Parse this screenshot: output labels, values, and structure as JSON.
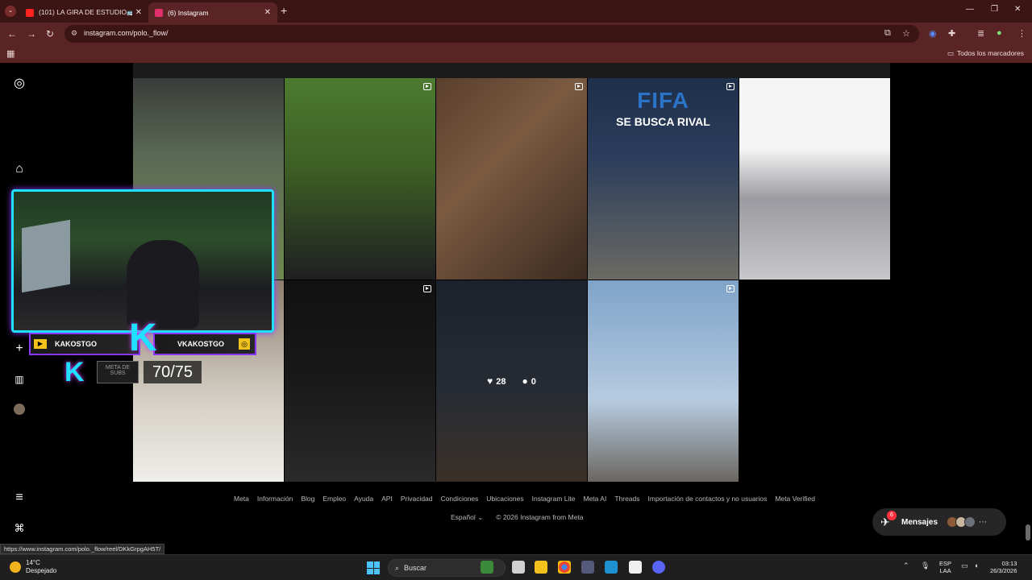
{
  "browser": {
    "tab_menu_icon": "chevron-down-icon",
    "tabs": [
      {
        "label": "(101) LA GIRA DE ESTUDIO🚌🎒",
        "favicon_color": "#ff2020"
      },
      {
        "label": "(6) Instagram",
        "favicon_color": "#e1306c"
      }
    ],
    "new_tab": "+",
    "window": {
      "minimize": "—",
      "restore": "❐",
      "close": "✕"
    },
    "url": "instagram.com/polo._flow/",
    "bookmarks_all": "Todos los marcadores"
  },
  "instagram": {
    "grid": [
      [
        {
          "name": "post-1",
          "reel": false,
          "bg": "linear-gradient(180deg,#3a3d3a 0%,#5c6a55 40%,#6f8a4d 100%)"
        },
        {
          "name": "post-2",
          "reel": true,
          "bg": "linear-gradient(180deg,#4c7a2f 0%,#3d5f24 45%,#1f1f22 100%)"
        },
        {
          "name": "post-3",
          "reel": true,
          "bg": "linear-gradient(135deg,#5a3f2d 0%,#7a5a41 40%,#3b2a20 100%)"
        },
        {
          "name": "post-4",
          "reel": true,
          "bg": "linear-gradient(180deg,#1e2f4a 0%,#2c3e5c 40%,#6b6a63 100%)",
          "headline_1": "FIFA",
          "headline_2": "SE BUSCA RIVAL"
        },
        {
          "name": "post-5",
          "reel": false,
          "bg": "linear-gradient(180deg,#f5f5f5 0%,#f5f5f5 35%,#9a9ba0 60%,#c8c8cc 100%)"
        }
      ],
      [
        {
          "name": "post-6",
          "reel": false,
          "bg": "linear-gradient(180deg,#8d7f6e 0%,#d5d0c6 60%,#efeeea 100%)"
        },
        {
          "name": "post-7",
          "reel": true,
          "bg": "linear-gradient(180deg,#111 0%,#191919 50%,#2a2a2a 100%)"
        },
        {
          "name": "post-8",
          "reel": true,
          "bg": "linear-gradient(180deg,#2c3545 0%,#3c4350 55%,#5a4b3e 100%)"
        },
        {
          "name": "post-9",
          "reel": true,
          "bg": "linear-gradient(180deg,#7fa3c9 0%,#b6cbe0 60%,#6b6660 100%)"
        }
      ]
    ],
    "hover": {
      "likes": "28",
      "comments": "0",
      "like_icon": "heart-icon",
      "comment_icon": "speech-bubble-icon"
    },
    "footer_links": [
      "Meta",
      "Información",
      "Blog",
      "Empleo",
      "Ayuda",
      "API",
      "Privacidad",
      "Condiciones",
      "Ubicaciones",
      "Instagram Lite",
      "Meta AI",
      "Threads",
      "Importación de contactos y no usuarios",
      "Meta Verified"
    ],
    "language": "Español ⌄",
    "copyright": "© 2026 Instagram from Meta",
    "messages": {
      "label": "Mensajes",
      "badge": "6"
    },
    "status_url": "https://www.instagram.com/polo._flow/reel/DKkGrpgAH5T/"
  },
  "overlay": {
    "name_left": "KAKOSTGO",
    "name_right": "VKAKOSTGO",
    "k_logo": "K",
    "subs_label": "META DE SUBS",
    "subs_count": "70/75"
  },
  "taskbar": {
    "temperature": "14°C",
    "condition": "Despejado",
    "search": "Buscar",
    "lang_1": "ESP",
    "lang_2": "LAA",
    "time": "03:13",
    "date": "26/3/2026"
  }
}
